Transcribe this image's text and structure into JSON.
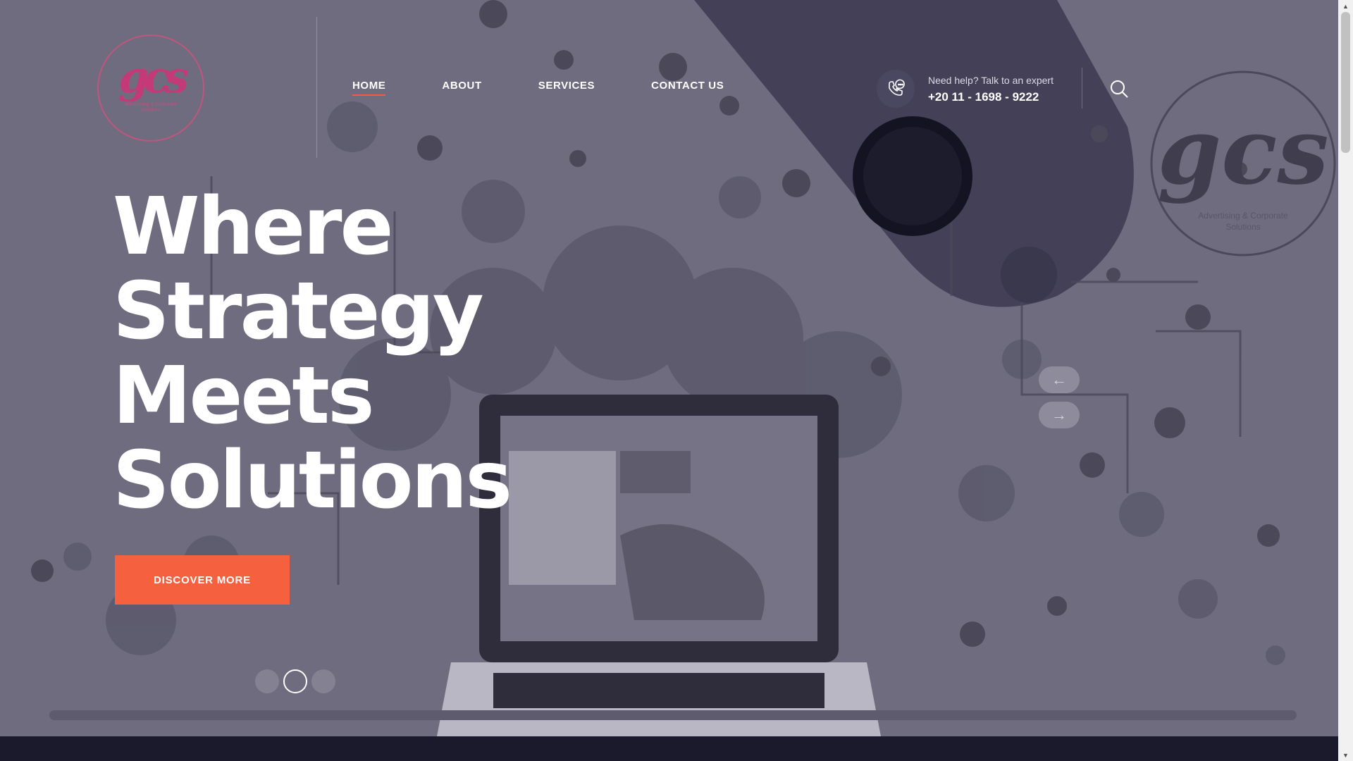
{
  "brand": {
    "logo_mark": "gcs",
    "logo_sub": "Advertising & Corporate Solutions"
  },
  "nav": {
    "items": [
      {
        "label": "HOME"
      },
      {
        "label": "ABOUT"
      },
      {
        "label": "SERVICES"
      },
      {
        "label": "CONTACT US"
      }
    ]
  },
  "help": {
    "label": "Need help? Talk to an expert",
    "phone": "+20 11 - 1698 - 9222"
  },
  "hero": {
    "headline_lines": [
      "Where",
      "Strategy",
      "Meets",
      "Solutions"
    ],
    "cta_label": "DISCOVER MORE",
    "prev_arrow": "←",
    "next_arrow": "→",
    "slides_total": 3,
    "active_slide": 2
  },
  "colors": {
    "accent": "#f5613f",
    "hero_bg": "#6f6c80",
    "dark_band": "#1b1a2c",
    "logo_pink": "#c43a78"
  },
  "icons": {
    "phone": "phone-chat-icon",
    "search": "search-icon",
    "prev": "arrow-left-icon",
    "next": "arrow-right-icon"
  }
}
